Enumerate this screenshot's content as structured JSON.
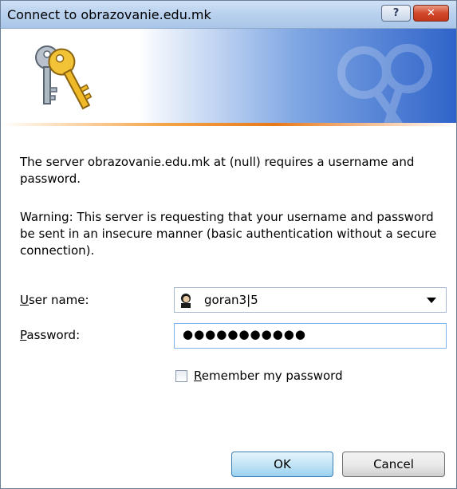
{
  "window": {
    "title": "Connect to obrazovanie.edu.mk",
    "help_label": "?",
    "close_label": "✕"
  },
  "banner": {
    "icon": "keys-icon",
    "accent_colors": [
      "#2f63c9",
      "#e8791a"
    ]
  },
  "message": {
    "line1": "The server obrazovanie.edu.mk at (null) requires a username and password.",
    "warning": "Warning: This server is requesting that your username and password be sent in an insecure manner (basic authentication without a secure connection)."
  },
  "form": {
    "username_label_accel": "U",
    "username_label_rest": "ser name:",
    "username_value": "goran3|5",
    "username_icon": "user-icon",
    "password_label_accel": "P",
    "password_label_rest": "assword:",
    "password_masked": "●●●●●●●●●●●",
    "remember_accel": "R",
    "remember_rest": "emember my password",
    "remember_checked": false
  },
  "buttons": {
    "ok": "OK",
    "cancel": "Cancel"
  }
}
